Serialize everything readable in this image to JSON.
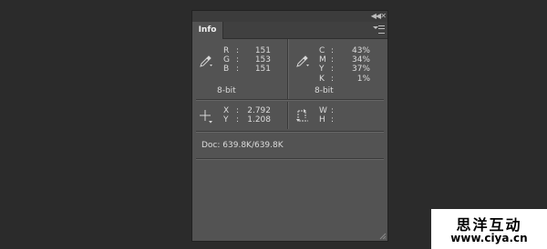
{
  "window": {
    "collapse_icon": "double-chevron-left-icon",
    "close_icon": "close-icon",
    "tab_label": "Info",
    "menu_icon": "panel-menu-icon"
  },
  "rgb": {
    "icon": "eyedropper-icon",
    "rows": [
      {
        "label": "R",
        "colon": ":",
        "value": "151"
      },
      {
        "label": "G",
        "colon": ":",
        "value": "153"
      },
      {
        "label": "B",
        "colon": ":",
        "value": "151"
      }
    ],
    "bit_depth": "8-bit"
  },
  "cmyk": {
    "icon": "eyedropper-icon",
    "rows": [
      {
        "label": "C",
        "colon": ":",
        "value": "43%"
      },
      {
        "label": "M",
        "colon": ":",
        "value": "34%"
      },
      {
        "label": "Y",
        "colon": ":",
        "value": "37%"
      },
      {
        "label": "K",
        "colon": ":",
        "value": "1%"
      }
    ],
    "bit_depth": "8-bit"
  },
  "position": {
    "icon": "crosshair-icon",
    "rows": [
      {
        "label": "X",
        "colon": ":",
        "value": "2.792"
      },
      {
        "label": "Y",
        "colon": ":",
        "value": "1.208"
      }
    ]
  },
  "size": {
    "icon": "selection-size-icon",
    "rows": [
      {
        "label": "W",
        "colon": ":"
      },
      {
        "label": "H",
        "colon": ":"
      }
    ]
  },
  "doc": {
    "text": "Doc: 639.8K/639.8K"
  },
  "resize_icon": "resize-grip-icon",
  "watermark": {
    "title": "思洋互动",
    "url": "www.ciya.cn"
  }
}
